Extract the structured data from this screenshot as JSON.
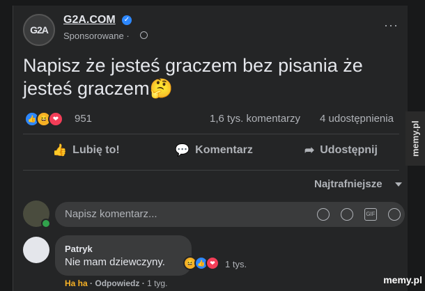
{
  "post": {
    "page_name": "G2A.COM",
    "avatar_text": "G2A",
    "sponsored_label": "Sponsorowane ·",
    "more_glyph": "···",
    "verified_glyph": "✓",
    "text": "Napisz że jesteś graczem bez pisania że jesteś graczem🤔"
  },
  "stats": {
    "reaction_count": "951",
    "comments": "1,6 tys. komentarzy",
    "shares": "4 udostępnienia",
    "reactions": [
      "like",
      "haha",
      "love"
    ],
    "reaction_glyphs": [
      "👍",
      "😆",
      "❤"
    ]
  },
  "actions": {
    "like": {
      "label": "Lubię to!",
      "icon_glyph": "👍"
    },
    "comment": {
      "label": "Komentarz",
      "icon_glyph": "💬"
    },
    "share": {
      "label": "Udostępnij",
      "icon_glyph": "➦"
    }
  },
  "sort": {
    "label": "Najtrafniejsze"
  },
  "comment_box": {
    "placeholder": "Napisz komentarz...",
    "icons": [
      "emoji-icon",
      "camera-icon",
      "gif-icon",
      "sticker-icon"
    ],
    "gif_text": "GIF"
  },
  "comment": {
    "author": "Patryk",
    "text": "Nie mam dziewczyny.",
    "reaction_count": "1 tys.",
    "reactions": [
      "haha",
      "like",
      "love"
    ],
    "actions": {
      "haha": "Ha ha",
      "reply": "Odpowiedz",
      "time": "1 tyg."
    }
  },
  "watermark": {
    "side": "memy.pl",
    "corner": "memy.pl"
  },
  "colors": {
    "background": "#18191a",
    "card": "#242526",
    "text": "#e4e6eb",
    "muted": "#b0b3b8",
    "accent": "#2d88ff"
  }
}
